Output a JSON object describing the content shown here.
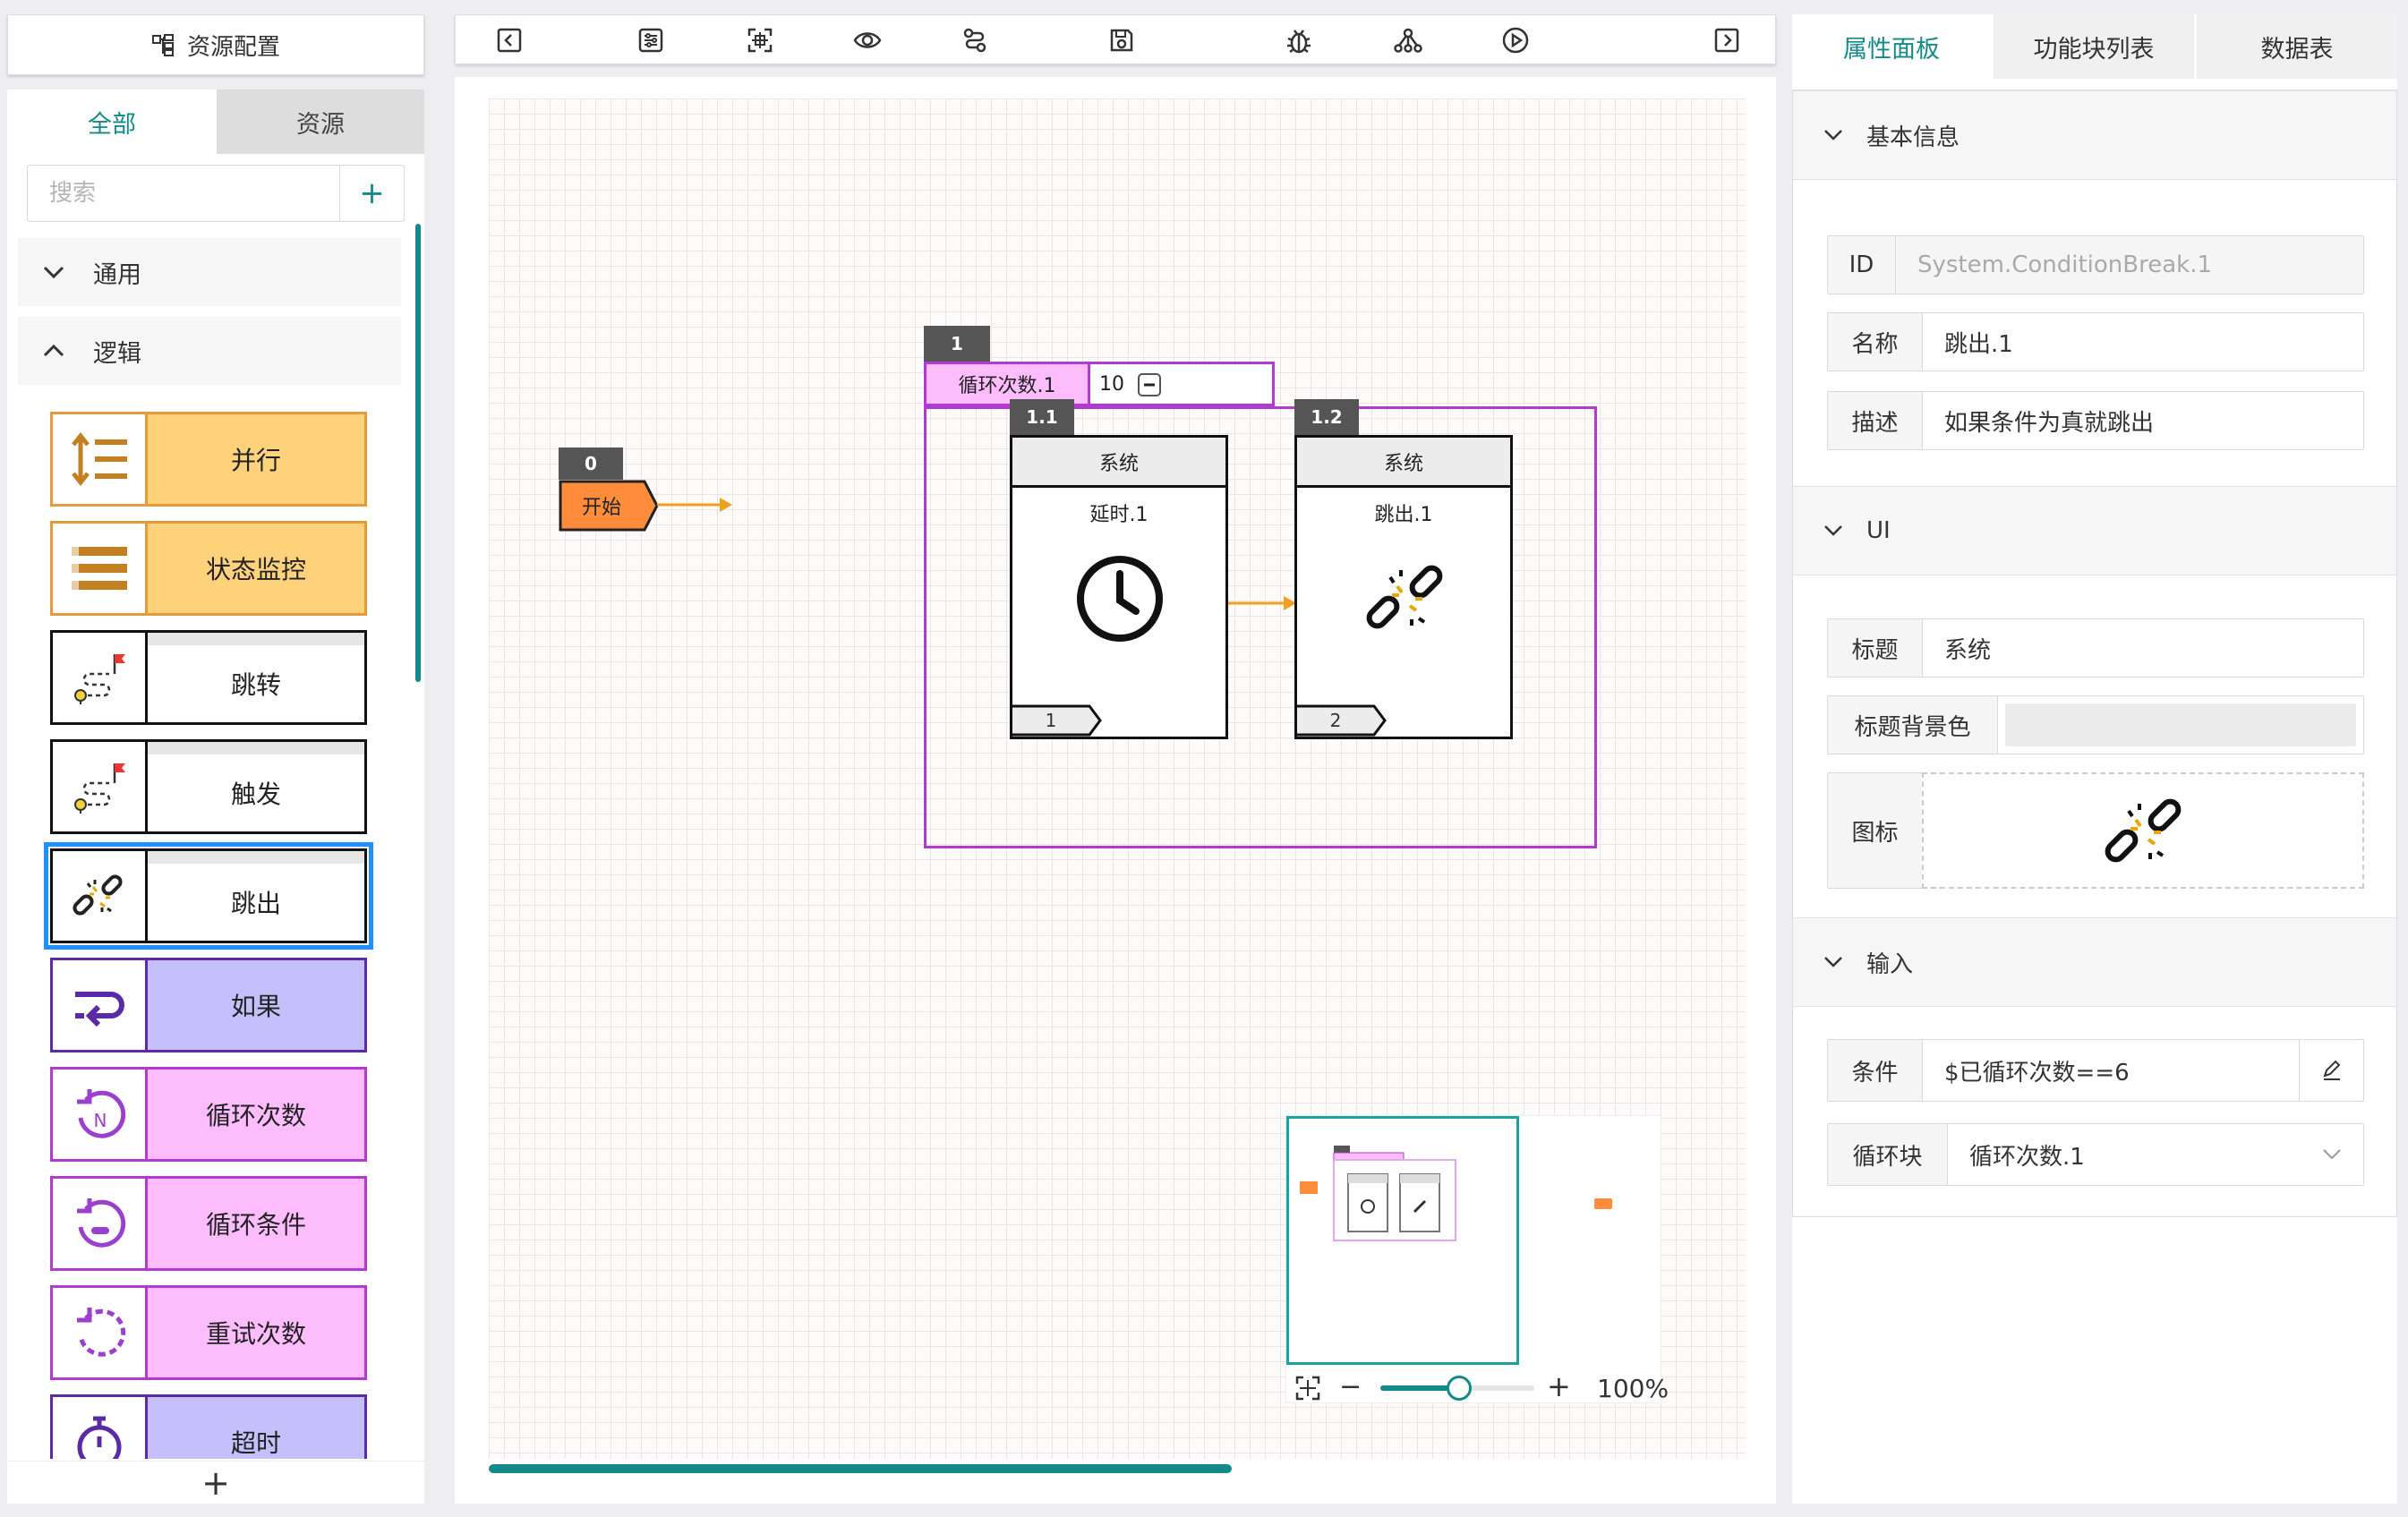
{
  "left": {
    "header_title": "资源配置",
    "tabs": [
      "全部",
      "资源"
    ],
    "search_placeholder": "搜索",
    "groups": [
      "通用",
      "逻辑"
    ],
    "blocks": [
      "并行",
      "状态监控",
      "跳转",
      "触发",
      "跳出",
      "如果",
      "循环次数",
      "循环条件",
      "重试次数",
      "超时"
    ],
    "colors": {
      "yellow": "#fdd27a",
      "yellow_border": "#e49b3c",
      "purple": "#c5c0fb",
      "purple_border": "#5b2aa8",
      "pink": "#fdbdfd",
      "pink_border": "#b13ad1",
      "selected": "#1e90ff"
    }
  },
  "toolbar": {
    "icons": [
      "collapse-left-icon",
      "settings-sliders-icon",
      "fit-view-icon",
      "eye-icon",
      "route-icon",
      "save-icon",
      "debug-bug-icon",
      "network-icon",
      "play-icon",
      "collapse-right-icon"
    ]
  },
  "canvas": {
    "start_tag": "0",
    "start_label": "开始",
    "loop_tag": "1",
    "loop_label": "循环次数.1",
    "loop_value": "10",
    "nodes": [
      {
        "tag": "1.1",
        "header": "系统",
        "title": "延时.1",
        "port": "1",
        "icon": "clock-icon"
      },
      {
        "tag": "1.2",
        "header": "系统",
        "title": "跳出.1",
        "port": "2",
        "icon": "broken-chain-icon"
      }
    ],
    "zoom": "100%",
    "accent": "#138a8a",
    "arrow_color": "#f0a020",
    "loop_color": "#b13ad1"
  },
  "right": {
    "tabs": [
      "属性面板",
      "功能块列表",
      "数据表"
    ],
    "sections": {
      "basic": "基本信息",
      "ui": "UI",
      "input": "输入"
    },
    "fields": {
      "id_label": "ID",
      "id_value": "System.ConditionBreak.1",
      "name_label": "名称",
      "name_value": "跳出.1",
      "desc_label": "描述",
      "desc_value": "如果条件为真就跳出",
      "title_label": "标题",
      "title_value": "系统",
      "title_bg_label": "标题背景色",
      "icon_label": "图标",
      "cond_label": "条件",
      "cond_value": "$已循环次数==6",
      "loop_label": "循环块",
      "loop_value": "循环次数.1"
    }
  }
}
